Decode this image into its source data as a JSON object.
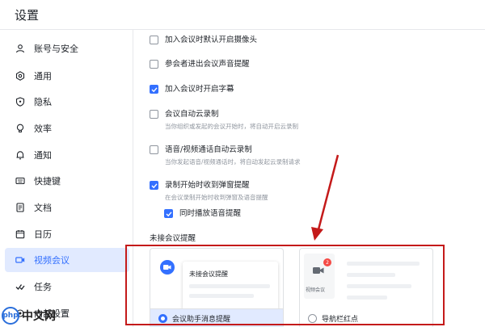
{
  "window": {
    "title": "设置"
  },
  "sidebar": {
    "items": [
      {
        "label": "账号与安全",
        "icon": "user-icon"
      },
      {
        "label": "通用",
        "icon": "gear-icon"
      },
      {
        "label": "隐私",
        "icon": "shield-icon"
      },
      {
        "label": "效率",
        "icon": "lightbulb-icon"
      },
      {
        "label": "通知",
        "icon": "bell-icon"
      },
      {
        "label": "快捷键",
        "icon": "keyboard-icon"
      },
      {
        "label": "文档",
        "icon": "document-icon"
      },
      {
        "label": "日历",
        "icon": "calendar-icon"
      },
      {
        "label": "视频会议",
        "icon": "video-icon",
        "active": true
      },
      {
        "label": "任务",
        "icon": "task-check-icon"
      },
      {
        "label": "内部设置",
        "icon": "settings-icon"
      }
    ]
  },
  "options": [
    {
      "label": "加入会议时默认开启摄像头",
      "checked": false
    },
    {
      "label": "参会者进出会议声音提醒",
      "checked": false
    },
    {
      "label": "加入会议时开启字幕",
      "checked": true
    },
    {
      "label": "会议自动云录制",
      "desc": "当你组织或发起的会议开始时，将自动开启云录制",
      "checked": false
    },
    {
      "label": "语音/视频通话自动云录制",
      "desc": "当你发起语音/视频通话时，将自动发起云录制请求",
      "checked": false
    },
    {
      "label": "录制开始时收到弹窗提醒",
      "desc": "在会议录制开始时收到弹窗及语音提醒",
      "checked": true
    },
    {
      "label": "同时播放语音提醒",
      "checked": true
    }
  ],
  "missed_reminder": {
    "section_title": "未接会议提醒",
    "card_left": {
      "popup_title": "未接会议提醒",
      "radio_label": "会议助手消息提醒",
      "selected": true
    },
    "card_right": {
      "app_label": "视频会议",
      "badge_count": "2",
      "radio_label": "导航栏红点",
      "selected": false
    }
  },
  "watermark": {
    "logo": "php",
    "text": "中文网"
  },
  "colors": {
    "accent": "#3370ff",
    "active_bg": "#e1eaff",
    "annotation_red": "#c41a1a"
  }
}
